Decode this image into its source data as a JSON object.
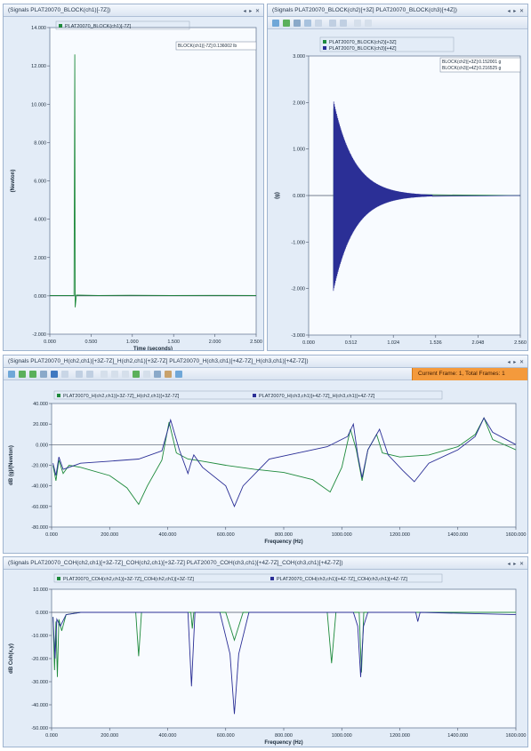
{
  "panels": {
    "p1": {
      "title": "(Signals PLAT20070_BLOCK(ch1)[-7Z])",
      "legend": [
        "PLAT20070_BLOCK(ch1)[-7Z]"
      ],
      "cursor_readout": [
        "BLOCK(ch1)[-7Z]:0.136002 lb"
      ]
    },
    "p2": {
      "title": "(Signals PLAT20070_BLOCK(ch2)[+3Z] PLAT20070_BLOCK(ch3)[+4Z])",
      "legend": [
        "PLAT20070_BLOCK(ch2)[+3Z]",
        "PLAT20070_BLOCK(ch3)[+4Z]"
      ],
      "cursor_readout": [
        "BLOCK(ch2)[+3Z]:0.152001 g",
        "BLOCK(ch3)[+4Z]:0.216525 g"
      ]
    },
    "p3": {
      "title": "(Signals PLAT20070_H(ch2,ch1)[+3Z-7Z]_H(ch2,ch1)[+3Z-7Z] PLAT20070_H(ch3,ch1)[+4Z-7Z]_H(ch3,ch1)[+4Z-7Z])",
      "legend": [
        "PLAT20070_H(ch2,ch1)[+3Z-7Z]_H(ch2,ch1)[+3Z-7Z]",
        "PLAT20070_H(ch3,ch1)[+4Z-7Z]_H(ch3,ch1)[+4Z-7Z]"
      ],
      "frame_status": "Current Frame: 1, Total Frames: 1"
    },
    "p4": {
      "title": "(Signals PLAT20070_COH(ch2,ch1)[+3Z-7Z]_COH(ch2,ch1)[+3Z-7Z] PLAT20070_COH(ch3,ch1)[+4Z-7Z]_COH(ch3,ch1)[+4Z-7Z])",
      "legend": [
        "PLAT20070_COH(ch2,ch1)[+3Z-7Z]_COH(ch2,ch1)[+3Z-7Z]",
        "PLAT20070_COH(ch3,ch1)[+4Z-7Z]_COH(ch3,ch1)[+4Z-7Z]"
      ]
    },
    "window_controls": "◂ ▸ ✕"
  },
  "colors": {
    "series_green": "#1e8a3c",
    "series_blue": "#2b2f96",
    "plot_bg": "#f8fbff",
    "frame_badge": "#f49a3c"
  },
  "chart_data": [
    {
      "type": "line",
      "xlabel": "Time (seconds)",
      "ylabel": "(Newton)",
      "xlim": [
        0,
        2.56
      ],
      "ylim": [
        -2000,
        14000
      ],
      "x_ticks": [
        "0.000",
        "0.500",
        "1.000",
        "1.500",
        "2.000",
        "2.500"
      ],
      "y_ticks": [
        "-2.000",
        "0.000",
        "2.000",
        "4.000",
        "6.000",
        "8.000",
        "10.000",
        "12.000",
        "14.000"
      ],
      "series": [
        {
          "name": "PLAT20070_BLOCK(ch1)[-7Z]",
          "color": "#1e8a3c",
          "points": [
            [
              0,
              20
            ],
            [
              0.3,
              20
            ],
            [
              0.31,
              12600
            ],
            [
              0.315,
              -600
            ],
            [
              0.33,
              40
            ],
            [
              0.6,
              20
            ],
            [
              1.0,
              30
            ],
            [
              1.5,
              20
            ],
            [
              2.0,
              25
            ],
            [
              2.56,
              20
            ]
          ]
        }
      ],
      "grid": false,
      "legend_position": "top-left"
    },
    {
      "type": "line",
      "xlabel": "",
      "ylabel": "(g)",
      "xlim": [
        0,
        2.56
      ],
      "ylim": [
        -3,
        3
      ],
      "x_ticks": [
        "0.000",
        "0.512",
        "1.024",
        "1.536",
        "2.048",
        "2.560"
      ],
      "y_ticks": [
        "-3.000",
        "-2.000",
        "-1.000",
        "0.000",
        "1.000",
        "2.000",
        "3.000"
      ],
      "series": [
        {
          "name": "PLAT20070_BLOCK(ch2)[+3Z]",
          "color": "#1e8a3c",
          "envelope": {
            "start": 0.3,
            "peak": 1.9,
            "decay": 0.22,
            "end": 1.3
          }
        },
        {
          "name": "PLAT20070_BLOCK(ch3)[+4Z]",
          "color": "#2b2f96",
          "envelope": {
            "start": 0.3,
            "peak": 2.05,
            "decay": 0.25,
            "end": 1.5
          }
        }
      ],
      "grid": false,
      "legend_position": "top-left"
    },
    {
      "type": "line",
      "xlabel": "Frequency (Hz)",
      "ylabel": "dB (g)/(Newton)",
      "xlim": [
        0,
        1600
      ],
      "ylim": [
        -80,
        40
      ],
      "x_ticks": [
        "0.000",
        "200.000",
        "400.000",
        "600.000",
        "800.000",
        "1000.000",
        "1200.000",
        "1400.000",
        "1600.000"
      ],
      "y_ticks": [
        "-80.000",
        "-60.000",
        "-40.000",
        "-20.000",
        "0.000",
        "20.000",
        "40.000"
      ],
      "series": [
        {
          "name": "PLAT20070_H(ch2,ch1)[+3Z-7Z]_H(ch2,ch1)[+3Z-7Z]",
          "color": "#1e8a3c",
          "points": [
            [
              5,
              -20
            ],
            [
              15,
              -35
            ],
            [
              25,
              -15
            ],
            [
              40,
              -28
            ],
            [
              60,
              -20
            ],
            [
              100,
              -22
            ],
            [
              200,
              -30
            ],
            [
              260,
              -42
            ],
            [
              300,
              -58
            ],
            [
              330,
              -40
            ],
            [
              380,
              -15
            ],
            [
              405,
              22
            ],
            [
              430,
              -8
            ],
            [
              470,
              -14
            ],
            [
              520,
              -16
            ],
            [
              600,
              -20
            ],
            [
              700,
              -24
            ],
            [
              800,
              -27
            ],
            [
              900,
              -34
            ],
            [
              960,
              -46
            ],
            [
              1000,
              -22
            ],
            [
              1030,
              15
            ],
            [
              1050,
              -5
            ],
            [
              1070,
              -35
            ],
            [
              1090,
              -5
            ],
            [
              1120,
              10
            ],
            [
              1140,
              -8
            ],
            [
              1200,
              -12
            ],
            [
              1300,
              -10
            ],
            [
              1400,
              -2
            ],
            [
              1460,
              10
            ],
            [
              1490,
              26
            ],
            [
              1520,
              5
            ],
            [
              1600,
              -5
            ]
          ]
        },
        {
          "name": "PLAT20070_H(ch3,ch1)[+4Z-7Z]_H(ch3,ch1)[+4Z-7Z]",
          "color": "#2b2f96",
          "points": [
            [
              5,
              -18
            ],
            [
              15,
              -30
            ],
            [
              25,
              -12
            ],
            [
              40,
              -24
            ],
            [
              60,
              -22
            ],
            [
              100,
              -18
            ],
            [
              200,
              -16
            ],
            [
              300,
              -14
            ],
            [
              380,
              -6
            ],
            [
              410,
              24
            ],
            [
              440,
              -5
            ],
            [
              470,
              -28
            ],
            [
              480,
              -18
            ],
            [
              490,
              -10
            ],
            [
              520,
              -22
            ],
            [
              600,
              -40
            ],
            [
              630,
              -60
            ],
            [
              660,
              -40
            ],
            [
              750,
              -14
            ],
            [
              850,
              -8
            ],
            [
              950,
              -2
            ],
            [
              1020,
              8
            ],
            [
              1040,
              20
            ],
            [
              1055,
              -10
            ],
            [
              1070,
              -32
            ],
            [
              1090,
              -5
            ],
            [
              1130,
              15
            ],
            [
              1160,
              -10
            ],
            [
              1210,
              -25
            ],
            [
              1250,
              -36
            ],
            [
              1300,
              -18
            ],
            [
              1400,
              -5
            ],
            [
              1460,
              8
            ],
            [
              1490,
              26
            ],
            [
              1520,
              12
            ],
            [
              1600,
              0
            ]
          ]
        }
      ],
      "grid": false,
      "legend_position": "top-left"
    },
    {
      "type": "line",
      "xlabel": "Frequency (Hz)",
      "ylabel": "dB Coh(x,y)",
      "xlim": [
        0,
        1600
      ],
      "ylim": [
        -50,
        10
      ],
      "x_ticks": [
        "0.000",
        "200.000",
        "400.000",
        "600.000",
        "800.000",
        "1000.000",
        "1200.000",
        "1400.000",
        "1600.000"
      ],
      "y_ticks": [
        "-50.000",
        "-40.000",
        "-30.000",
        "-20.000",
        "-10.000",
        "0.000",
        "10.000"
      ],
      "series": [
        {
          "name": "PLAT20070_COH(ch2,ch1)[+3Z-7Z]_COH(ch2,ch1)[+3Z-7Z]",
          "color": "#1e8a3c",
          "points": [
            [
              5,
              -2
            ],
            [
              10,
              -25
            ],
            [
              15,
              -4
            ],
            [
              20,
              -28
            ],
            [
              25,
              -3
            ],
            [
              35,
              -8
            ],
            [
              50,
              -1
            ],
            [
              100,
              0
            ],
            [
              290,
              0
            ],
            [
              300,
              -19
            ],
            [
              310,
              0
            ],
            [
              480,
              0
            ],
            [
              485,
              -7
            ],
            [
              490,
              0
            ],
            [
              600,
              0
            ],
            [
              630,
              -12
            ],
            [
              660,
              0
            ],
            [
              950,
              0
            ],
            [
              965,
              -22
            ],
            [
              980,
              0
            ],
            [
              1060,
              0
            ],
            [
              1068,
              -26
            ],
            [
              1076,
              0
            ],
            [
              1600,
              0
            ]
          ]
        },
        {
          "name": "PLAT20070_COH(ch3,ch1)[+4Z-7Z]_COH(ch3,ch1)[+4Z-7Z]",
          "color": "#2b2f96",
          "points": [
            [
              5,
              -2
            ],
            [
              12,
              -20
            ],
            [
              18,
              -3
            ],
            [
              30,
              -6
            ],
            [
              50,
              -1
            ],
            [
              100,
              0
            ],
            [
              470,
              0
            ],
            [
              482,
              -32
            ],
            [
              494,
              0
            ],
            [
              580,
              0
            ],
            [
              615,
              -18
            ],
            [
              630,
              -44
            ],
            [
              645,
              -18
            ],
            [
              680,
              0
            ],
            [
              1040,
              0
            ],
            [
              1055,
              -6
            ],
            [
              1065,
              -28
            ],
            [
              1075,
              -6
            ],
            [
              1090,
              0
            ],
            [
              1255,
              0
            ],
            [
              1262,
              -4
            ],
            [
              1270,
              0
            ],
            [
              1600,
              -1
            ]
          ]
        }
      ],
      "grid": false,
      "legend_position": "top-left"
    }
  ]
}
